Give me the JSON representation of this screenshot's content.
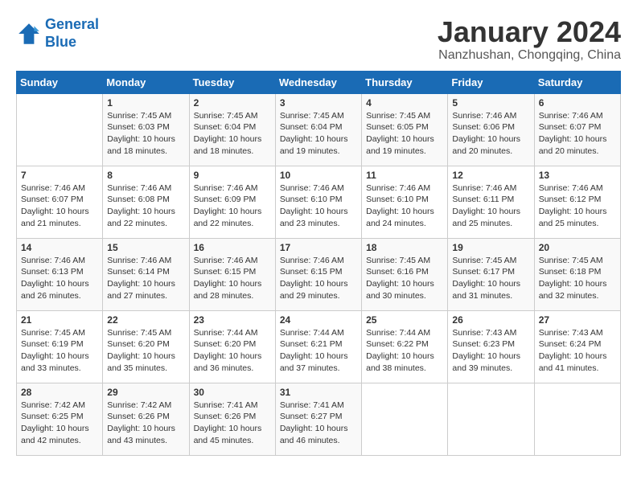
{
  "header": {
    "logo_line1": "General",
    "logo_line2": "Blue",
    "month_title": "January 2024",
    "subtitle": "Nanzhushan, Chongqing, China"
  },
  "weekdays": [
    "Sunday",
    "Monday",
    "Tuesday",
    "Wednesday",
    "Thursday",
    "Friday",
    "Saturday"
  ],
  "weeks": [
    [
      {
        "day": "",
        "info": ""
      },
      {
        "day": "1",
        "info": "Sunrise: 7:45 AM\nSunset: 6:03 PM\nDaylight: 10 hours\nand 18 minutes."
      },
      {
        "day": "2",
        "info": "Sunrise: 7:45 AM\nSunset: 6:04 PM\nDaylight: 10 hours\nand 18 minutes."
      },
      {
        "day": "3",
        "info": "Sunrise: 7:45 AM\nSunset: 6:04 PM\nDaylight: 10 hours\nand 19 minutes."
      },
      {
        "day": "4",
        "info": "Sunrise: 7:45 AM\nSunset: 6:05 PM\nDaylight: 10 hours\nand 19 minutes."
      },
      {
        "day": "5",
        "info": "Sunrise: 7:46 AM\nSunset: 6:06 PM\nDaylight: 10 hours\nand 20 minutes."
      },
      {
        "day": "6",
        "info": "Sunrise: 7:46 AM\nSunset: 6:07 PM\nDaylight: 10 hours\nand 20 minutes."
      }
    ],
    [
      {
        "day": "7",
        "info": "Sunrise: 7:46 AM\nSunset: 6:07 PM\nDaylight: 10 hours\nand 21 minutes."
      },
      {
        "day": "8",
        "info": "Sunrise: 7:46 AM\nSunset: 6:08 PM\nDaylight: 10 hours\nand 22 minutes."
      },
      {
        "day": "9",
        "info": "Sunrise: 7:46 AM\nSunset: 6:09 PM\nDaylight: 10 hours\nand 22 minutes."
      },
      {
        "day": "10",
        "info": "Sunrise: 7:46 AM\nSunset: 6:10 PM\nDaylight: 10 hours\nand 23 minutes."
      },
      {
        "day": "11",
        "info": "Sunrise: 7:46 AM\nSunset: 6:10 PM\nDaylight: 10 hours\nand 24 minutes."
      },
      {
        "day": "12",
        "info": "Sunrise: 7:46 AM\nSunset: 6:11 PM\nDaylight: 10 hours\nand 25 minutes."
      },
      {
        "day": "13",
        "info": "Sunrise: 7:46 AM\nSunset: 6:12 PM\nDaylight: 10 hours\nand 25 minutes."
      }
    ],
    [
      {
        "day": "14",
        "info": "Sunrise: 7:46 AM\nSunset: 6:13 PM\nDaylight: 10 hours\nand 26 minutes."
      },
      {
        "day": "15",
        "info": "Sunrise: 7:46 AM\nSunset: 6:14 PM\nDaylight: 10 hours\nand 27 minutes."
      },
      {
        "day": "16",
        "info": "Sunrise: 7:46 AM\nSunset: 6:15 PM\nDaylight: 10 hours\nand 28 minutes."
      },
      {
        "day": "17",
        "info": "Sunrise: 7:46 AM\nSunset: 6:15 PM\nDaylight: 10 hours\nand 29 minutes."
      },
      {
        "day": "18",
        "info": "Sunrise: 7:45 AM\nSunset: 6:16 PM\nDaylight: 10 hours\nand 30 minutes."
      },
      {
        "day": "19",
        "info": "Sunrise: 7:45 AM\nSunset: 6:17 PM\nDaylight: 10 hours\nand 31 minutes."
      },
      {
        "day": "20",
        "info": "Sunrise: 7:45 AM\nSunset: 6:18 PM\nDaylight: 10 hours\nand 32 minutes."
      }
    ],
    [
      {
        "day": "21",
        "info": "Sunrise: 7:45 AM\nSunset: 6:19 PM\nDaylight: 10 hours\nand 33 minutes."
      },
      {
        "day": "22",
        "info": "Sunrise: 7:45 AM\nSunset: 6:20 PM\nDaylight: 10 hours\nand 35 minutes."
      },
      {
        "day": "23",
        "info": "Sunrise: 7:44 AM\nSunset: 6:20 PM\nDaylight: 10 hours\nand 36 minutes."
      },
      {
        "day": "24",
        "info": "Sunrise: 7:44 AM\nSunset: 6:21 PM\nDaylight: 10 hours\nand 37 minutes."
      },
      {
        "day": "25",
        "info": "Sunrise: 7:44 AM\nSunset: 6:22 PM\nDaylight: 10 hours\nand 38 minutes."
      },
      {
        "day": "26",
        "info": "Sunrise: 7:43 AM\nSunset: 6:23 PM\nDaylight: 10 hours\nand 39 minutes."
      },
      {
        "day": "27",
        "info": "Sunrise: 7:43 AM\nSunset: 6:24 PM\nDaylight: 10 hours\nand 41 minutes."
      }
    ],
    [
      {
        "day": "28",
        "info": "Sunrise: 7:42 AM\nSunset: 6:25 PM\nDaylight: 10 hours\nand 42 minutes."
      },
      {
        "day": "29",
        "info": "Sunrise: 7:42 AM\nSunset: 6:26 PM\nDaylight: 10 hours\nand 43 minutes."
      },
      {
        "day": "30",
        "info": "Sunrise: 7:41 AM\nSunset: 6:26 PM\nDaylight: 10 hours\nand 45 minutes."
      },
      {
        "day": "31",
        "info": "Sunrise: 7:41 AM\nSunset: 6:27 PM\nDaylight: 10 hours\nand 46 minutes."
      },
      {
        "day": "",
        "info": ""
      },
      {
        "day": "",
        "info": ""
      },
      {
        "day": "",
        "info": ""
      }
    ]
  ]
}
